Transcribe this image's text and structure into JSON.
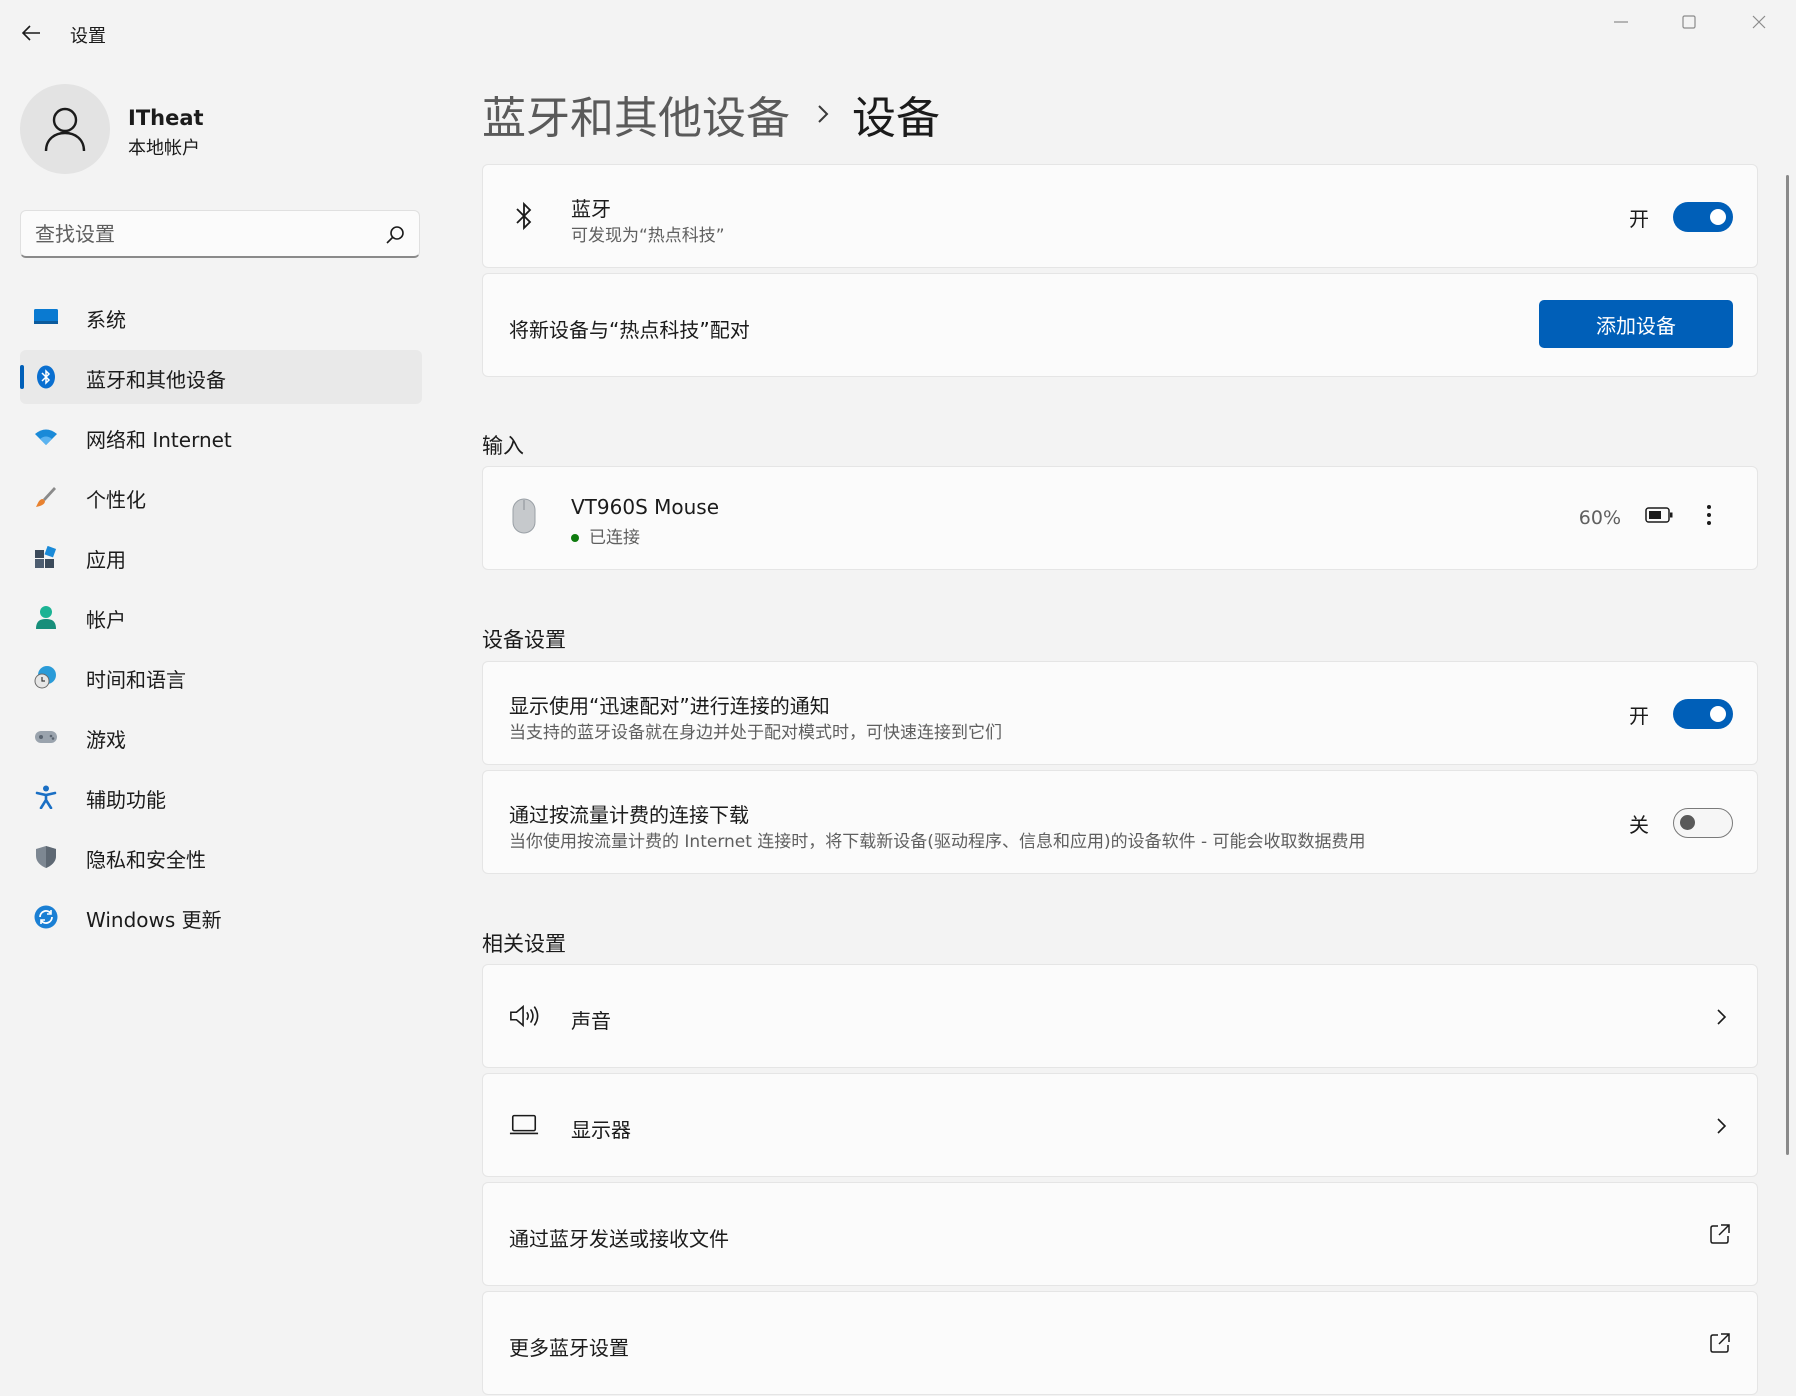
{
  "titlebar": {
    "title": "设置"
  },
  "profile": {
    "name": "ITheat",
    "account_type": "本地帐户"
  },
  "search": {
    "placeholder": "查找设置"
  },
  "sidebar": {
    "items": [
      {
        "label": "系统",
        "icon": "system-icon"
      },
      {
        "label": "蓝牙和其他设备",
        "icon": "bluetooth-icon",
        "active": true
      },
      {
        "label": "网络和 Internet",
        "icon": "wifi-icon"
      },
      {
        "label": "个性化",
        "icon": "brush-icon"
      },
      {
        "label": "应用",
        "icon": "apps-icon"
      },
      {
        "label": "帐户",
        "icon": "account-icon"
      },
      {
        "label": "时间和语言",
        "icon": "globe-clock-icon"
      },
      {
        "label": "游戏",
        "icon": "gamepad-icon"
      },
      {
        "label": "辅助功能",
        "icon": "accessibility-icon"
      },
      {
        "label": "隐私和安全性",
        "icon": "shield-icon"
      },
      {
        "label": "Windows 更新",
        "icon": "update-icon"
      }
    ]
  },
  "breadcrumb": {
    "parent": "蓝牙和其他设备",
    "current": "设备"
  },
  "bluetooth": {
    "title": "蓝牙",
    "subtitle": "可发现为“热点科技”",
    "state": "开",
    "enabled": true
  },
  "pair": {
    "label": "将新设备与“热点科技”配对",
    "button": "添加设备"
  },
  "input_section": {
    "title": "输入",
    "device": {
      "name": "VT960S Mouse",
      "status": "已连接",
      "battery": "60%"
    }
  },
  "device_settings": {
    "title": "设备设置",
    "swift_pair": {
      "title": "显示使用“迅速配对”进行连接的通知",
      "subtitle": "当支持的蓝牙设备就在身边并处于配对模式时，可快速连接到它们",
      "state": "开",
      "enabled": true
    },
    "metered": {
      "title": "通过按流量计费的连接下载",
      "subtitle": "当你使用按流量计费的 Internet 连接时，将下载新设备(驱动程序、信息和应用)的设备软件 - 可能会收取数据费用",
      "state": "关",
      "enabled": false
    }
  },
  "related": {
    "title": "相关设置",
    "items": [
      {
        "label": "声音",
        "icon": "speaker-icon",
        "kind": "nav"
      },
      {
        "label": "显示器",
        "icon": "laptop-icon",
        "kind": "nav"
      },
      {
        "label": "通过蓝牙发送或接收文件",
        "kind": "external"
      },
      {
        "label": "更多蓝牙设置",
        "kind": "external"
      }
    ]
  },
  "colors": {
    "accent": "#005fb8",
    "connected": "#0f7b0f",
    "background": "#f3f3f3",
    "card": "#fbfbfb"
  }
}
